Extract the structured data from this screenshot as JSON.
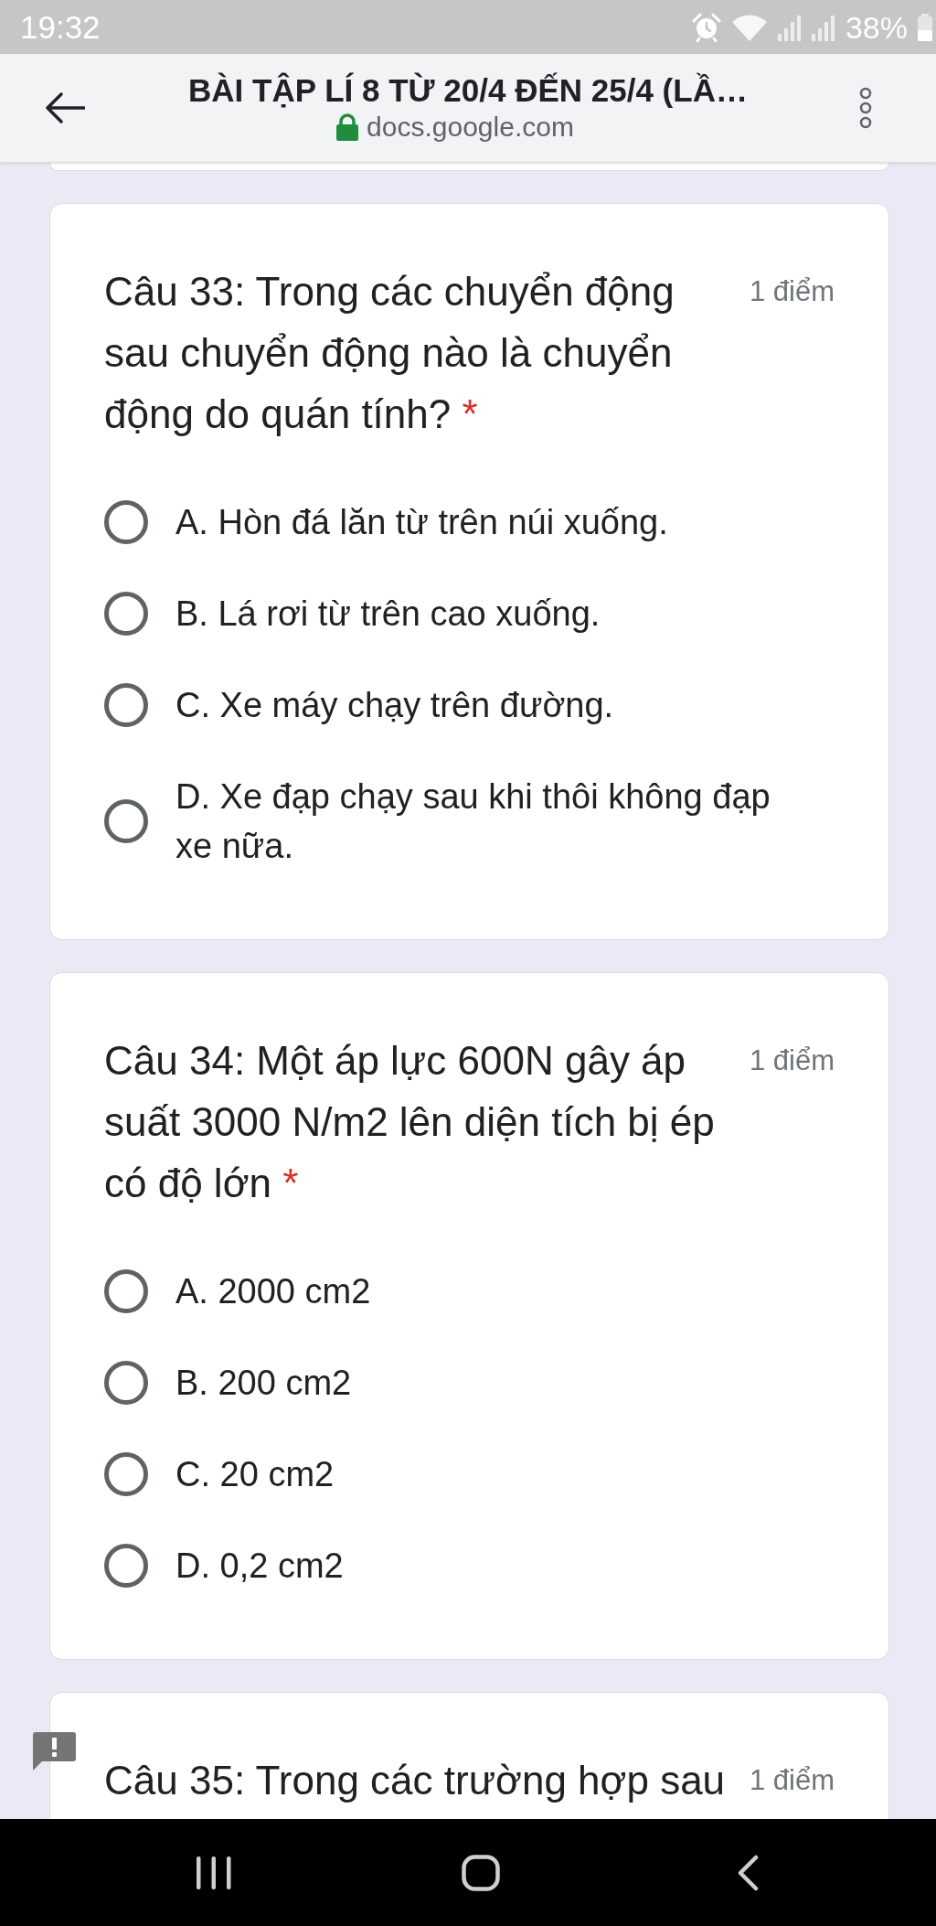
{
  "status_bar": {
    "time": "19:32",
    "battery": "38%"
  },
  "browser_bar": {
    "title": "BÀI TẬP LÍ 8 TỪ 20/4 ĐẾN 25/4 (LẦ…",
    "url": "docs.google.com"
  },
  "questions": [
    {
      "title": "Câu 33: Trong các chuyển động sau chuyển động nào là chuyển động do quán tính?",
      "required_mark": "*",
      "points": "1 điểm",
      "flagged": false,
      "options": [
        {
          "label": "A. Hòn đá lăn từ trên núi xuống.",
          "selected": false
        },
        {
          "label": "B. Lá rơi từ trên cao xuống.",
          "selected": false
        },
        {
          "label": "C. Xe máy chạy trên đường.",
          "selected": false
        },
        {
          "label": "D. Xe đạp chạy sau khi thôi không đạp xe nữa.",
          "selected": false
        }
      ]
    },
    {
      "title": "Câu 34: Một áp lực 600N gây áp suất 3000 N/m2 lên diện tích bị ép có độ lớn",
      "required_mark": "*",
      "points": "1 điểm",
      "flagged": false,
      "options": [
        {
          "label": "A. 2000 cm2",
          "selected": false
        },
        {
          "label": "B. 200 cm2",
          "selected": false
        },
        {
          "label": "C. 20 cm2",
          "selected": false
        },
        {
          "label": "D. 0,2 cm2",
          "selected": false
        }
      ]
    },
    {
      "title": "Câu 35: Trong các trường hợp sau",
      "points": "1 điểm",
      "flagged": true
    }
  ]
}
